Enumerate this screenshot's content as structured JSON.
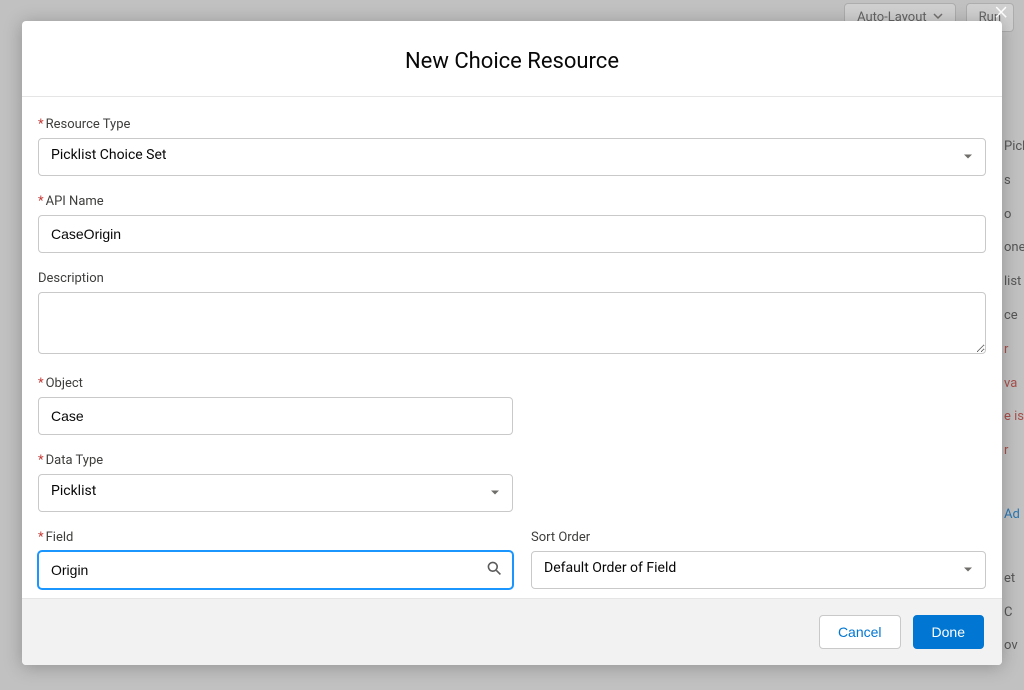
{
  "backdrop": {
    "auto_layout": "Auto-Layout",
    "run": "Run",
    "right_fragments": [
      "Pick",
      "s",
      "o",
      "oner",
      "list",
      "ce",
      "r va",
      "e is r",
      "Ad",
      "et C",
      "ov"
    ]
  },
  "modal": {
    "title": "New Choice Resource"
  },
  "labels": {
    "resource_type": "Resource Type",
    "api_name": "API Name",
    "description": "Description",
    "object": "Object",
    "data_type": "Data Type",
    "field": "Field",
    "sort_order": "Sort Order"
  },
  "values": {
    "resource_type": "Picklist Choice Set",
    "api_name": "CaseOrigin",
    "description": "",
    "object": "Case",
    "data_type": "Picklist",
    "field": "Origin",
    "sort_order": "Default Order of Field"
  },
  "footer": {
    "cancel": "Cancel",
    "done": "Done"
  }
}
